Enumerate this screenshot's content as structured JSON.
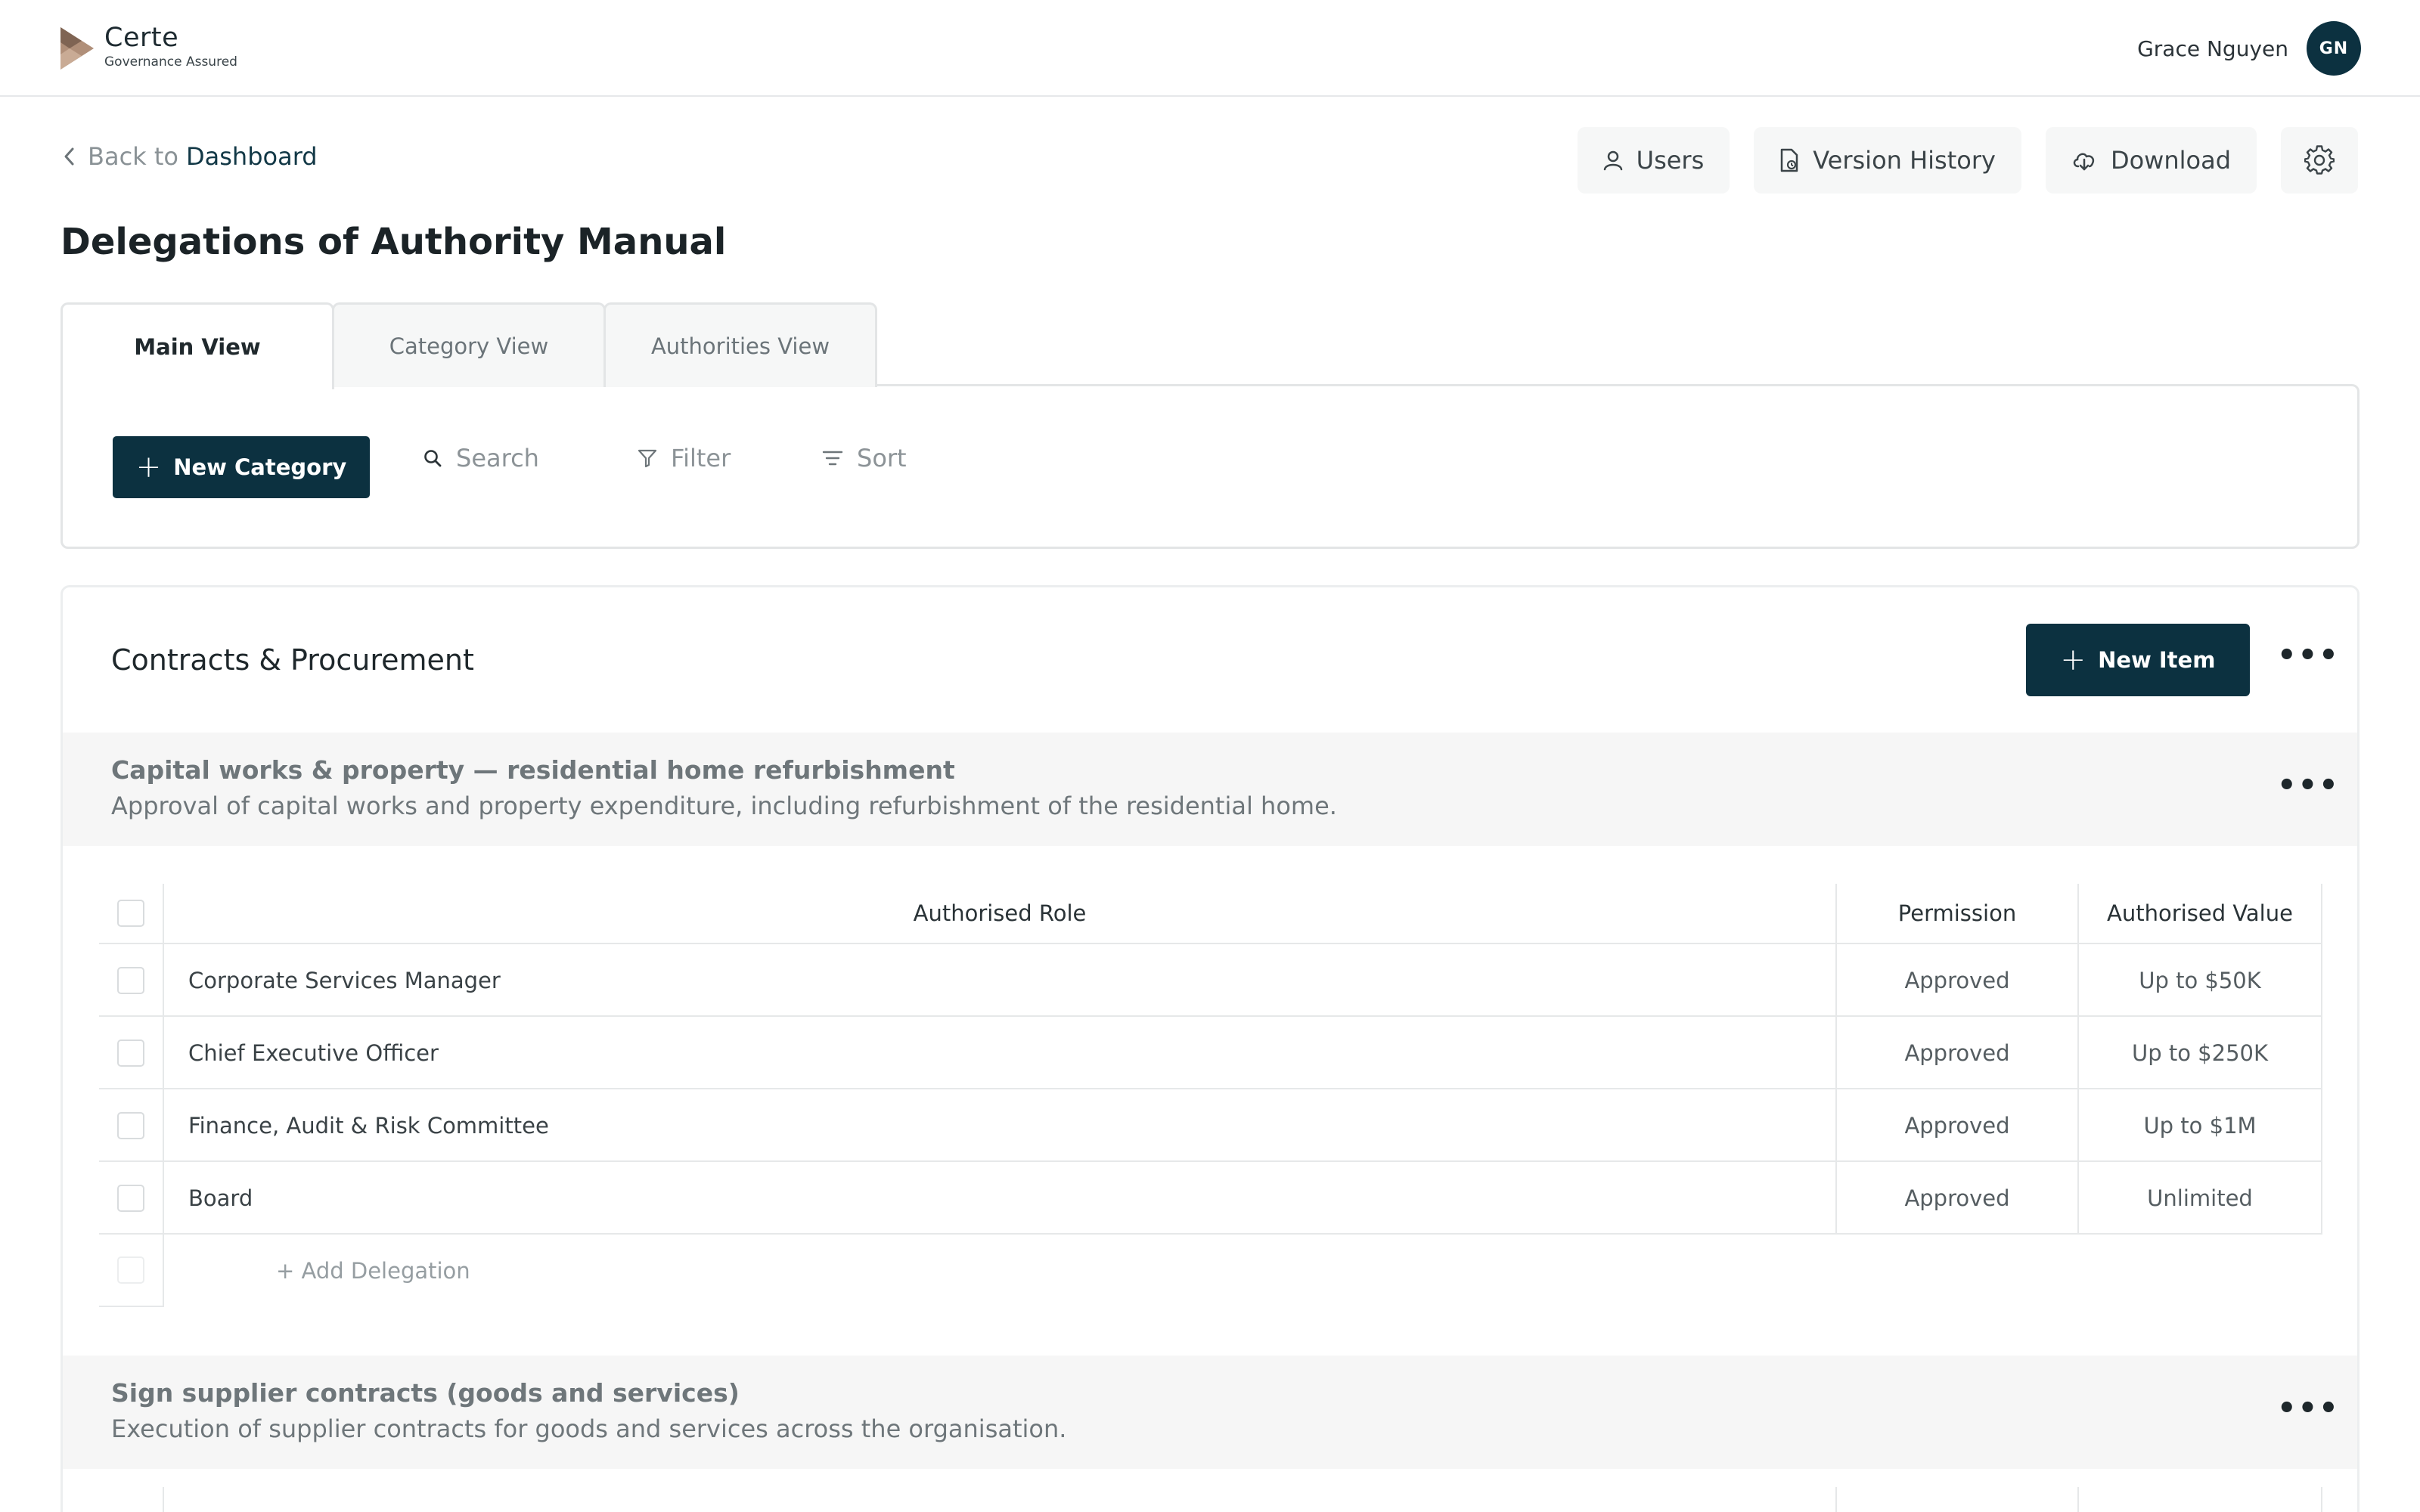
{
  "app": {
    "name": "Certe",
    "tagline": "Governance Assured"
  },
  "user": {
    "name": "Grace Nguyen",
    "initials": "GN"
  },
  "nav": {
    "back_prefix": "Back to",
    "back_link": "Dashboard"
  },
  "actions": {
    "users": "Users",
    "version_history": "Version History",
    "download": "Download"
  },
  "page": {
    "title": "Delegations of Authority Manual"
  },
  "tabs": [
    {
      "label": "Main View",
      "active": true
    },
    {
      "label": "Category View",
      "active": false
    },
    {
      "label": "Authorities View",
      "active": false
    }
  ],
  "toolbar": {
    "new_category": "New Category",
    "search": "Search",
    "filter": "Filter",
    "sort": "Sort"
  },
  "category": {
    "title": "Contracts & Procurement",
    "new_item": "New Item",
    "items": [
      {
        "title": "Capital works & property — residential home refurbishment",
        "description": "Approval of capital works and property expenditure, including refurbishment of the residential home.",
        "columns": [
          "Authorised Role",
          "Permission",
          "Authorised Value"
        ],
        "rows": [
          {
            "role": "Corporate Services Manager",
            "permission": "Approved",
            "value": "Up to $50K"
          },
          {
            "role": "Chief Executive Officer",
            "permission": "Approved",
            "value": "Up to $250K"
          },
          {
            "role": "Finance, Audit & Risk Committee",
            "permission": "Approved",
            "value": "Up to $1M"
          },
          {
            "role": "Board",
            "permission": "Approved",
            "value": "Unlimited"
          }
        ],
        "add_label": "+ Add Delegation"
      },
      {
        "title": "Sign supplier contracts (goods and services)",
        "description": "Execution of supplier contracts for goods and services across the organisation."
      }
    ]
  },
  "colors": {
    "primary": "#0c3140",
    "band": "#f6f6f6",
    "border": "#e3e5e6"
  }
}
